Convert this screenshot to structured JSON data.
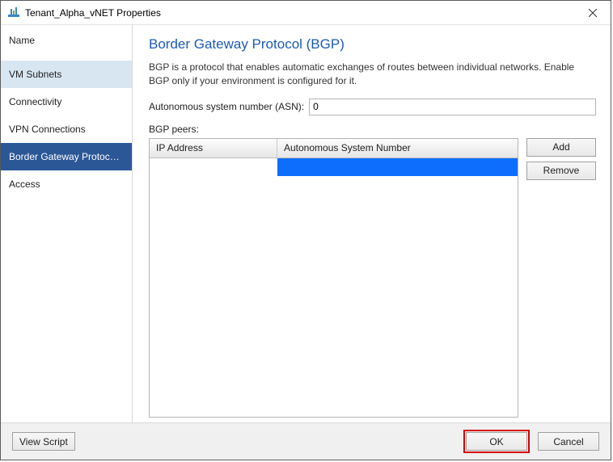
{
  "window": {
    "title": "Tenant_Alpha_vNET Properties"
  },
  "sidebar": {
    "header": "Name",
    "items": [
      {
        "label": "VM Subnets"
      },
      {
        "label": "Connectivity"
      },
      {
        "label": "VPN Connections"
      },
      {
        "label": "Border Gateway Protocol..."
      },
      {
        "label": "Access"
      }
    ]
  },
  "main": {
    "title": "Border Gateway Protocol (BGP)",
    "description": "BGP is a protocol that enables automatic exchanges of routes between individual networks. Enable BGP only if your environment is configured for it.",
    "asn_label": "Autonomous system number (ASN):",
    "asn_value": "0",
    "bgp_peers_label": "BGP peers:",
    "grid": {
      "columns": {
        "ip": "IP Address",
        "asn": "Autonomous System Number"
      },
      "rows": [
        {
          "ip": "",
          "asn": ""
        }
      ]
    },
    "buttons": {
      "add": "Add",
      "remove": "Remove"
    }
  },
  "footer": {
    "view_script": "View Script",
    "ok": "OK",
    "cancel": "Cancel"
  }
}
